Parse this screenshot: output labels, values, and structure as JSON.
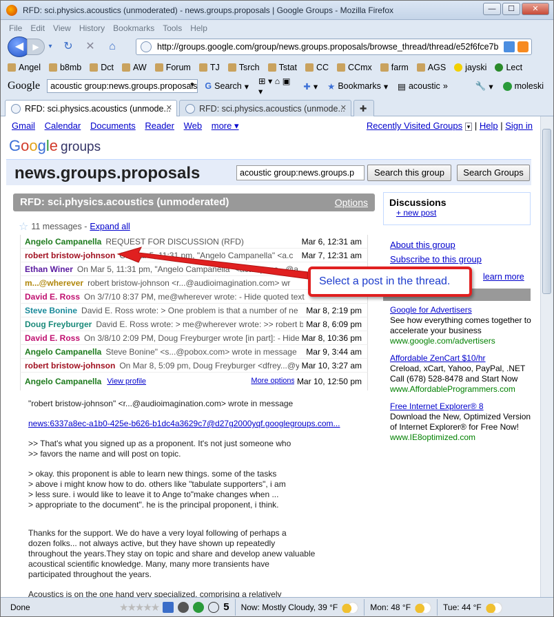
{
  "window": {
    "title": "RFD: sci.physics.acoustics (unmoderated) - news.groups.proposals | Google Groups - Mozilla Firefox"
  },
  "menu": [
    "File",
    "Edit",
    "View",
    "History",
    "Bookmarks",
    "Tools",
    "Help"
  ],
  "url": "http://groups.google.com/group/news.groups.proposals/browse_thread/thread/e52f6fce7b",
  "bookmarks": [
    "Angel",
    "b8mb",
    "Dct",
    "AW",
    "Forum",
    "TJ",
    "Tsrch",
    "Tstat",
    "CC",
    "CCmx",
    "farm",
    "AGS",
    "jayski",
    "Lect"
  ],
  "gbar": {
    "logo": "Google",
    "search_value": "acoustic group:news.groups.proposals",
    "search": "Search",
    "bookmarks": "Bookmarks",
    "acoustic": "acoustic",
    "user": "moleski"
  },
  "tabs": [
    "RFD: sci.physics.acoustics (unmode...",
    "RFD: sci.physics.acoustics (unmode..."
  ],
  "toplinks": [
    "Gmail",
    "Calendar",
    "Documents",
    "Reader",
    "Web",
    "more ▾"
  ],
  "rightlinks": {
    "recent": "Recently Visited Groups",
    "help": "Help",
    "signin": "Sign in"
  },
  "logo": {
    "g1": "G",
    "g2": "o",
    "g3": "o",
    "g4": "g",
    "g5": "l",
    "g6": "e",
    "groups": "groups"
  },
  "group": {
    "name": "news.groups.proposals",
    "search_value": "acoustic group:news.groups.p",
    "search_group": "Search this group",
    "search_groups": "Search Groups"
  },
  "thread": {
    "title": "RFD: sci.physics.acoustics (unmoderated)",
    "options": "Options",
    "count": "11 messages - ",
    "expand": "Expand all"
  },
  "messages": [
    {
      "author": "Angelo Campanella",
      "color": "#1c7a1c",
      "snippet": "REQUEST FOR DISCUSSION (RFD)",
      "date": "Mar 6, 12:31 am"
    },
    {
      "author": "robert bristow-johnson",
      "color": "#a01020",
      "snippet": "On Mar 5, 11:31 pm, \"Angelo Campanella\" <a.c",
      "date": "Mar 7, 12:31 am"
    },
    {
      "author": "Ethan Winer",
      "color": "#5a1aa0",
      "snippet": "On Mar 5, 11:31 pm, \"Angelo Campanella\" <acampane...@a",
      "date": ""
    },
    {
      "author": "m...@wherever",
      "color": "#b0860a",
      "snippet": "robert bristow-johnson <r...@audioimagination.com> wr",
      "date": ""
    },
    {
      "author": "David E. Ross",
      "color": "#c01070",
      "snippet": "On 3/7/10 8:37 PM, me@wherever wrote: - Hide quoted text",
      "date": ""
    },
    {
      "author": "Steve Bonine",
      "color": "#1a8a9a",
      "snippet": "David E. Ross wrote: > One problem is that a number of ne",
      "date": "Mar 8, 2:19 pm"
    },
    {
      "author": "Doug Freyburger",
      "color": "#1a8a7a",
      "snippet": "David E. Ross wrote: > me@wherever wrote: >> robert b",
      "date": "Mar 8, 6:09 pm"
    },
    {
      "author": "David E. Ross",
      "color": "#c01070",
      "snippet": "On 3/8/10 2:09 PM, Doug Freyburger wrote [in part]: - Hide",
      "date": "Mar 8, 10:36 pm"
    },
    {
      "author": "Angelo Campanella",
      "color": "#1c7a1c",
      "snippet": "Steve Bonine\" <s...@pobox.com> wrote in message",
      "date": "Mar 9, 3:44 am"
    },
    {
      "author": "robert bristow-johnson",
      "color": "#a01020",
      "snippet": "On Mar 8, 5:09 pm, Doug Freyburger <dfrey...@y",
      "date": "Mar 10, 3:27 am"
    }
  ],
  "open_message": {
    "author": "Angelo Campanella",
    "view_profile": "View profile",
    "more_options": "More options",
    "date": "Mar 10, 12:50 pm"
  },
  "body": {
    "p1": "\"robert bristow-johnson\" <r...@audioimagination.com> wrote in message",
    "link": "news:6337a8ec-a1b0-425e-b626-b1dc4a3629c7@d27g2000yqf.googlegroups.com...",
    "p2a": ">> That's what you signed up as a proponent. It's not just someone who",
    "p2b": ">> favors the name and will post on topic.",
    "p3a": "> okay.  this proponent is able to learn new things.  some of the tasks",
    "p3b": "> above i might know how to do.  others like \"tabulate supporters\", i am",
    "p3c": "> less sure.  i would like to leave it to Ange to\"make changes when ...",
    "p3d": "> appropriate to the document\".  he is the principal proponent, i think.",
    "p4a": "   Thanks for the support. We do have a very loyal following of perhaps a",
    "p4b": "dozen folks... not always active, but they have shown up repeatedly",
    "p4c": "throughout the years.They stay on topic and share and develop anew valuable",
    "p4d": "acoustical scientific knowledge.  Many, many more transients have",
    "p4e": "participated throughout the years.",
    "p5": "   Acoustics is on the one hand very specialized, comprising a relatively"
  },
  "side": {
    "title": "Discussions",
    "new_post": "+ new post",
    "about": "About this group",
    "subscribe": "Subscribe to this group",
    "learn": "learn more"
  },
  "ads": [
    {
      "title": "Google for Advertisers",
      "text": "See how everything comes together to accelerate your business",
      "url": "www.google.com/advertisers"
    },
    {
      "title": "Affordable ZenCart $10/hr",
      "text": "Creload, xCart, Yahoo, PayPal, .NET Call (678) 528-8478 and Start Now",
      "url": "www.AffordableProgrammers.com"
    },
    {
      "title": "Free Internet Explorer® 8",
      "text": "Download the New, Optimized Version of Internet Explorer® for Free Now!",
      "url": "www.IE8optimized.com"
    }
  ],
  "callout": "Select a post in the thread.",
  "status": {
    "done": "Done",
    "num": "5",
    "w1": "Now: Mostly Cloudy, 39 °F",
    "w2": "Mon: 48 °F",
    "w3": "Tue: 44 °F"
  }
}
